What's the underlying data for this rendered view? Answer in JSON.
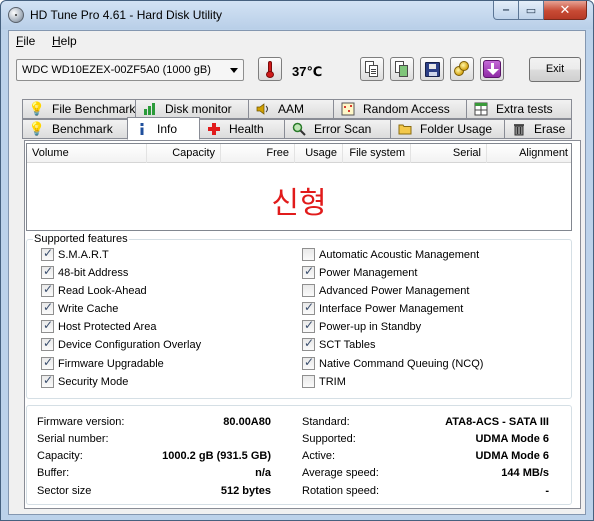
{
  "window": {
    "title": "HD Tune Pro 4.61 - Hard Disk Utility"
  },
  "menu": {
    "file_rest": "ile",
    "file_ul": "F",
    "help_rest": "elp",
    "help_ul": "H"
  },
  "toolbar": {
    "drive": "WDC WD10EZEX-00ZF5A0    (1000 gB)",
    "temperature": "37℃",
    "exit_label": "Exit"
  },
  "tabs": {
    "row1": [
      "File Benchmark",
      "Disk monitor",
      "AAM",
      "Random Access",
      "Extra tests"
    ],
    "row2": [
      "Benchmark",
      "Info",
      "Health",
      "Error Scan",
      "Folder Usage",
      "Erase"
    ],
    "active": "Info"
  },
  "volumes": {
    "columns": [
      "Volume",
      "Capacity",
      "Free",
      "Usage",
      "File system",
      "Serial",
      "Alignment"
    ],
    "overlay_text": "신형"
  },
  "features": {
    "title": "Supported features",
    "left": [
      {
        "label": "S.M.A.R.T",
        "checked": true
      },
      {
        "label": "48-bit Address",
        "checked": true
      },
      {
        "label": "Read Look-Ahead",
        "checked": true
      },
      {
        "label": "Write Cache",
        "checked": true
      },
      {
        "label": "Host Protected Area",
        "checked": true
      },
      {
        "label": "Device Configuration Overlay",
        "checked": true
      },
      {
        "label": "Firmware Upgradable",
        "checked": true
      },
      {
        "label": "Security Mode",
        "checked": true
      }
    ],
    "right": [
      {
        "label": "Automatic Acoustic Management",
        "checked": false
      },
      {
        "label": "Power Management",
        "checked": true
      },
      {
        "label": "Advanced Power Management",
        "checked": false
      },
      {
        "label": "Interface Power Management",
        "checked": true
      },
      {
        "label": "Power-up in Standby",
        "checked": true
      },
      {
        "label": "SCT Tables",
        "checked": true
      },
      {
        "label": "Native Command Queuing (NCQ)",
        "checked": true
      },
      {
        "label": "TRIM",
        "checked": false
      }
    ]
  },
  "info": {
    "left": [
      {
        "label": "Firmware version:",
        "value": "80.00A80"
      },
      {
        "label": "Serial number:",
        "value": ""
      },
      {
        "label": "Capacity:",
        "value": "1000.2 gB (931.5 GB)"
      },
      {
        "label": "Buffer:",
        "value": "n/a"
      },
      {
        "label": "Sector size",
        "value": "512 bytes"
      }
    ],
    "right": [
      {
        "label": "Standard:",
        "value": "ATA8-ACS - SATA III"
      },
      {
        "label": "Supported:",
        "value": "UDMA Mode 6"
      },
      {
        "label": "Active:",
        "value": "UDMA Mode 6"
      },
      {
        "label": "Average speed:",
        "value": "144 MB/s"
      },
      {
        "label": "Rotation speed:",
        "value": "-"
      }
    ]
  }
}
